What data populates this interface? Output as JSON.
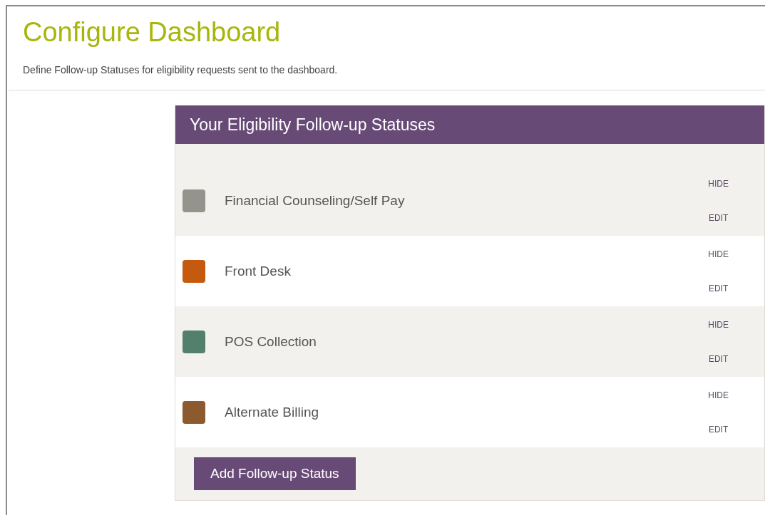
{
  "page": {
    "title": "Configure Dashboard",
    "description": "Define Follow-up Statuses for eligibility requests sent to the dashboard."
  },
  "panel": {
    "title": "Your Eligibility Follow-up Statuses",
    "statuses": [
      {
        "name": "Financial Counseling/Self Pay",
        "color": "#94948c",
        "hide": "HIDE",
        "edit": "EDIT"
      },
      {
        "name": "Front Desk",
        "color": "#c55a0e",
        "hide": "HIDE",
        "edit": "EDIT"
      },
      {
        "name": "POS Collection",
        "color": "#53806c",
        "hide": "HIDE",
        "edit": "EDIT"
      },
      {
        "name": "Alternate Billing",
        "color": "#8c5a2e",
        "hide": "HIDE",
        "edit": "EDIT"
      }
    ],
    "add_button": "Add Follow-up Status"
  }
}
